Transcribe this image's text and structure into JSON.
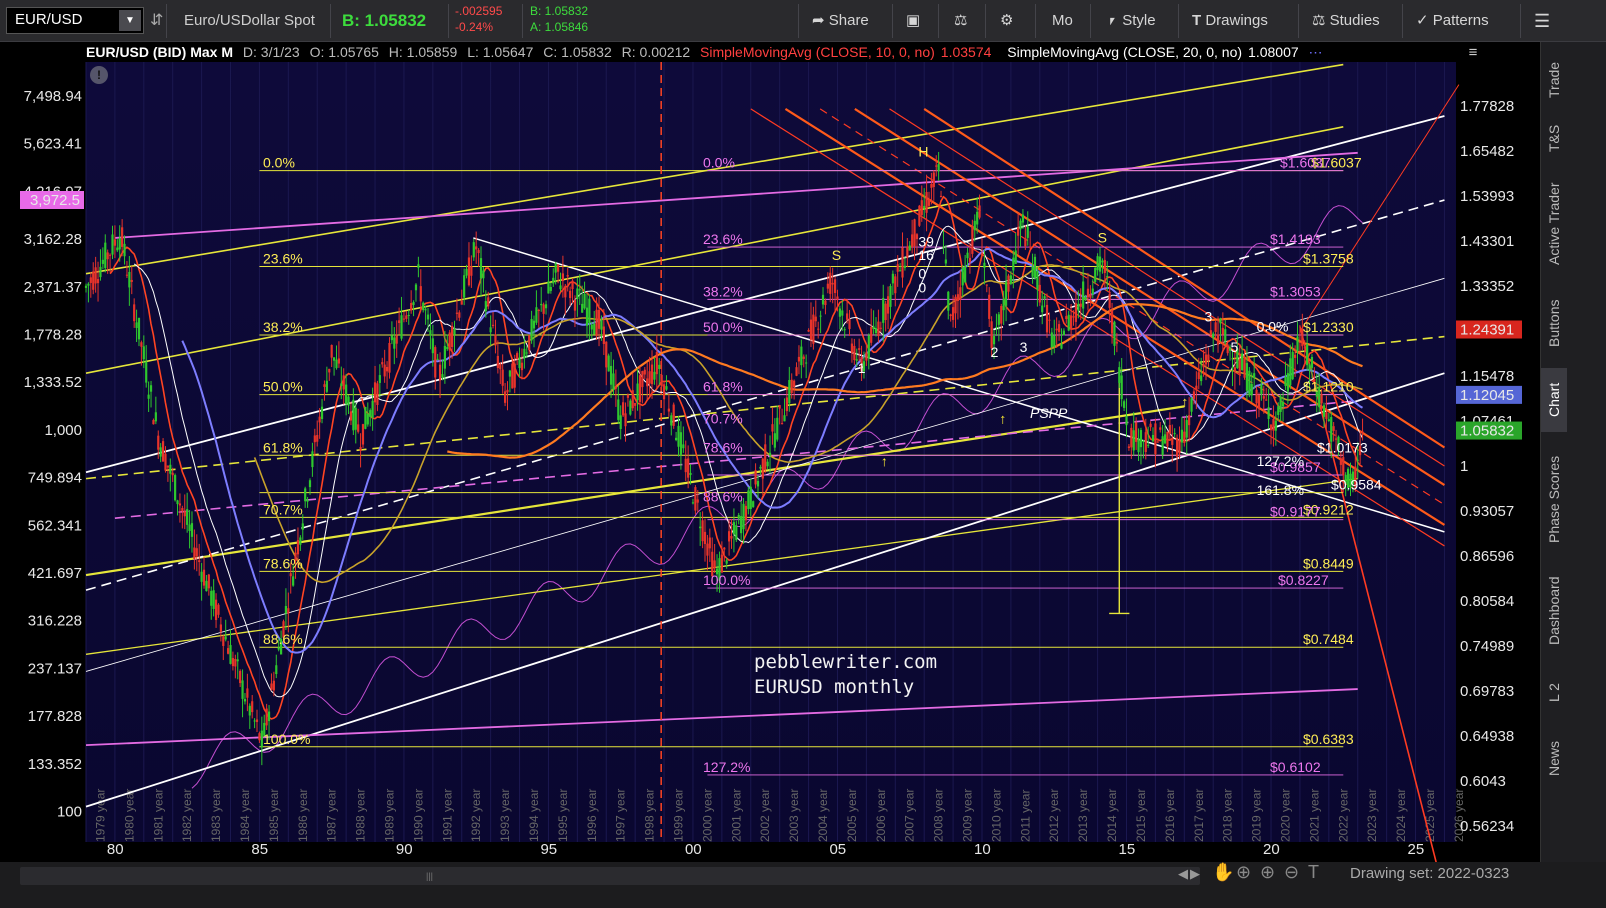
{
  "toolbar": {
    "symbol": "EUR/USD",
    "description": "Euro/USDollar Spot",
    "bid_big": "B: 1.05832",
    "change_abs": "-.002595",
    "change_pct": "-0.24%",
    "bid_small": "B: 1.05832",
    "ask_small": "A: 1.05846",
    "share": "Share",
    "mo": "Mo",
    "style": "Style",
    "drawings": "Drawings",
    "studies": "Studies",
    "patterns": "Patterns"
  },
  "infobar": {
    "title": "EUR/USD (BID) Max M",
    "date": "D: 3/1/23",
    "open": "O: 1.05765",
    "high": "H: 1.05859",
    "low": "L: 1.05647",
    "close": "C: 1.05832",
    "range": "R: 0.00212",
    "sma10": "SimpleMovingAvg (CLOSE, 10, 0, no)",
    "sma10_val": "1.03574",
    "sma20": "SimpleMovingAvg (CLOSE, 20, 0, no)",
    "sma20_val": "1.08007"
  },
  "chart_data": {
    "type": "candlestick",
    "symbol": "EUR/USD",
    "period": "monthly",
    "x_range": [
      1979,
      2026
    ],
    "left_axis": {
      "scale": "log",
      "ticks": [
        "7,498.94",
        "5,623.41",
        "4,216.97",
        "3,162.28",
        "2,371.37",
        "1,778.28",
        "1,333.52",
        "1,000",
        "749.894",
        "562.341",
        "421.697",
        "316.228",
        "237.137",
        "177.828",
        "133.352",
        "100"
      ],
      "badge": "3,972.5"
    },
    "right_axis": {
      "scale": "log",
      "ticks": [
        "1.77828",
        "1.65482",
        "1.53993",
        "1.43301",
        "1.33352",
        "1.24391",
        "1.15478",
        "1.07461",
        "1",
        "0.93057",
        "0.86596",
        "0.80584",
        "0.74989",
        "0.69783",
        "0.64938",
        "0.6043",
        "0.56234"
      ],
      "badges": [
        {
          "label": "1.24391",
          "color": "#d8261e"
        },
        {
          "label": "1.12045",
          "color": "#5566d6"
        },
        {
          "label": "1.05832",
          "color": "#2aa52a"
        }
      ]
    },
    "x_ticks": [
      "80",
      "85",
      "90",
      "95",
      "00",
      "05",
      "10",
      "15",
      "20",
      "25"
    ],
    "year_labels": [
      "1979 year",
      "1980 year",
      "1981 year",
      "1982 year",
      "1983 year",
      "1984 year",
      "1985 year",
      "1986 year",
      "1987 year",
      "1988 year",
      "1989 year",
      "1990 year",
      "1991 year",
      "1992 year",
      "1993 year",
      "1994 year",
      "1995 year",
      "1996 year",
      "1997 year",
      "1998 year",
      "1999 year",
      "2000 year",
      "2001 year",
      "2002 year",
      "2003 year",
      "2004 year",
      "2005 year",
      "2006 year",
      "2007 year",
      "2008 year",
      "2009 year",
      "2010 year",
      "2011 year",
      "2012 year",
      "2013 year",
      "2014 year",
      "2015 year",
      "2016 year",
      "2017 year",
      "2018 year",
      "2019 year",
      "2020 year",
      "2021 year",
      "2022 year",
      "2023 year",
      "2024 year",
      "2025 year",
      "2026 year"
    ],
    "fib_left": [
      {
        "label": "0.0%"
      },
      {
        "label": "23.6%"
      },
      {
        "label": "38.2%"
      },
      {
        "label": "50.0%"
      },
      {
        "label": "61.8%"
      },
      {
        "label": "70.7%"
      },
      {
        "label": "78.6%"
      },
      {
        "label": "88.6%"
      },
      {
        "label": "100.0%"
      }
    ],
    "fib_mid": [
      {
        "label": "0.0%"
      },
      {
        "label": "23.6%"
      },
      {
        "label": "38.2%"
      },
      {
        "label": "50.0%"
      },
      {
        "label": "61.8%"
      },
      {
        "label": "70.7%"
      },
      {
        "label": "78.6%"
      },
      {
        "label": "88.6%"
      },
      {
        "label": "100.0%"
      },
      {
        "label": "127.2%"
      }
    ],
    "price_labels": [
      {
        "label": "$1.6037",
        "color": "#ffee55"
      },
      {
        "label": "$1.6037",
        "color": "#ee77ee"
      },
      {
        "label": "$1.4193",
        "color": "#ee77ee"
      },
      {
        "label": "$1.3758",
        "color": "#ffee55"
      },
      {
        "label": "$1.3053",
        "color": "#ee77ee"
      },
      {
        "label": "$1.2330",
        "color": "#ffee55"
      },
      {
        "label": "$1.1210",
        "color": "#ffee55"
      },
      {
        "label": "$1.0173",
        "color": "#ffffff"
      },
      {
        "label": "$0.9857",
        "color": "#ee77ee"
      },
      {
        "label": "$0.9584",
        "color": "#ffffff"
      },
      {
        "label": "$0.9212",
        "color": "#ffee55"
      },
      {
        "label": "$0.9177",
        "color": "#ee77ee"
      },
      {
        "label": "$0.8449",
        "color": "#ffee55"
      },
      {
        "label": "$0.8227",
        "color": "#ee77ee"
      },
      {
        "label": "$0.7484",
        "color": "#ffee55"
      },
      {
        "label": "$0.6383",
        "color": "#ffee55"
      },
      {
        "label": "$0.6102",
        "color": "#ee77ee"
      }
    ],
    "wave_labels": [
      "H",
      "S",
      "S",
      "1",
      "2",
      "3",
      "3",
      "5",
      "39",
      "16",
      "0",
      "0",
      "0.0%",
      "127.2%",
      "161.8%"
    ],
    "pattern_label": "PSPP",
    "watermark_line1": "pebblewriter.com",
    "watermark_line2": "EURUSD monthly",
    "colors": {
      "up": "#2ec82e",
      "down": "#e8342a",
      "sma_red": "#ff4422",
      "sma_blue": "#7d7dff",
      "sma_gold": "#c8a22a",
      "fib_yellow": "#e6e63a",
      "magenta": "#e36be3"
    }
  },
  "rightnav": [
    "Trade",
    "T&S",
    "Active Trader",
    "Buttons",
    "Chart",
    "Phase Scores",
    "Dashboard",
    "L 2",
    "News"
  ],
  "bottom": {
    "drawing_set": "Drawing set: 2022-0323"
  }
}
